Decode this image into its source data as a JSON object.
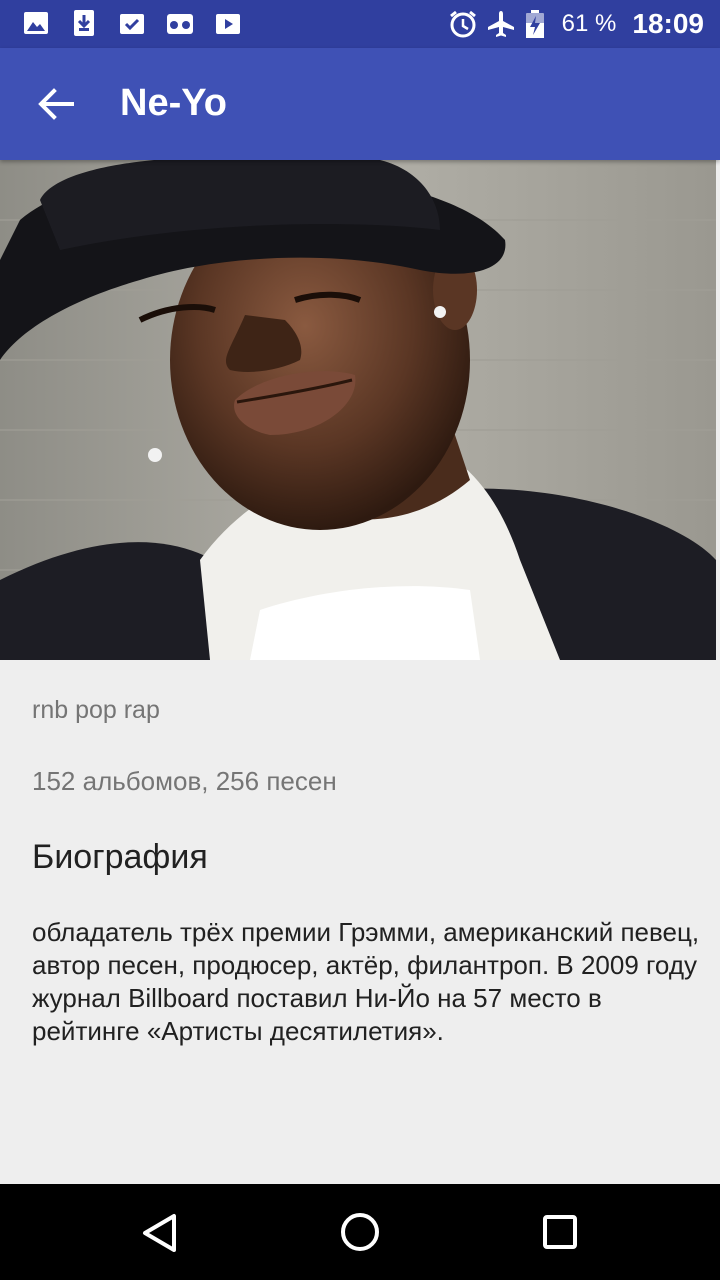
{
  "status_bar": {
    "notification_icons": [
      "image-icon",
      "download-icon",
      "tasks-icon",
      "voicemail-icon",
      "media-icon"
    ],
    "battery_percent": "61 %",
    "time": "18:09"
  },
  "app_bar": {
    "title": "Ne-Yo",
    "color": "#3f51b5"
  },
  "artist": {
    "genres": "rnb pop rap",
    "stats": "152 альбомов, 256 песен"
  },
  "biography": {
    "heading": "Биография",
    "text": "обладатель трёх премии Грэмми, американский певец, автор песен, продюсер, актёр, филантроп. В 2009 году журнал Billboard поставил Ни-Йо на 57 место в рейтинге «Артисты десятилетия»."
  },
  "nav_bar": {
    "buttons": [
      "back-triangle-icon",
      "home-circle-icon",
      "recents-square-icon"
    ]
  }
}
